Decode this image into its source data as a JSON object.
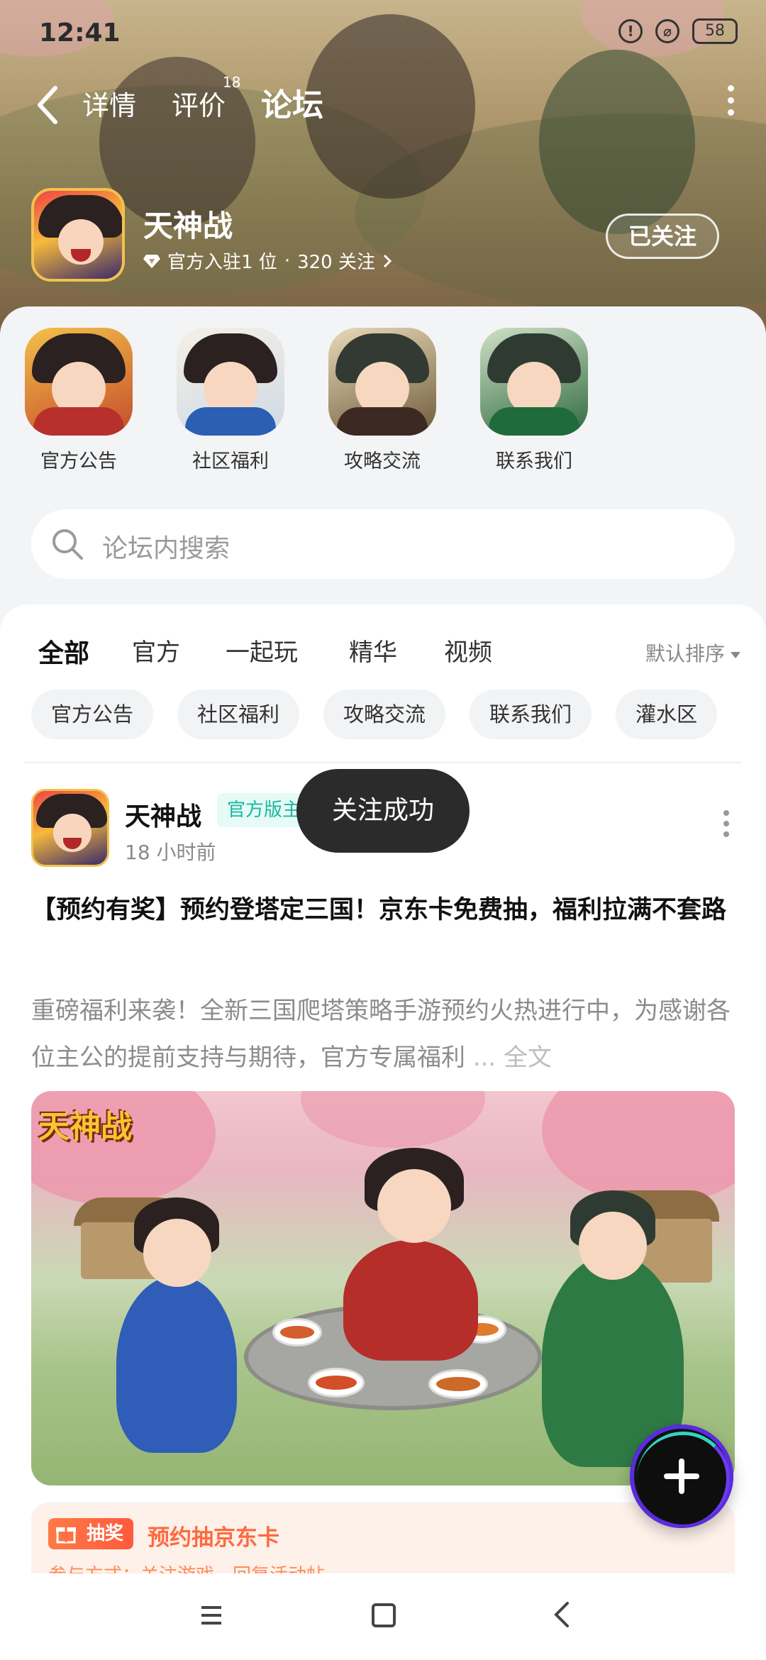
{
  "status_bar": {
    "time": "12:41",
    "battery": "58",
    "alert_icon": "!"
  },
  "nav": {
    "tabs": [
      {
        "label": "详情"
      },
      {
        "label": "评价",
        "badge": "18"
      },
      {
        "label": "论坛"
      }
    ],
    "active_tab": "论坛"
  },
  "forum": {
    "name": "天神战",
    "official_count": "官方入驻1 位",
    "followers": "320 关注",
    "follow_button": "已关注"
  },
  "shortcuts": [
    {
      "label": "官方公告"
    },
    {
      "label": "社区福利"
    },
    {
      "label": "攻略交流"
    },
    {
      "label": "联系我们"
    }
  ],
  "search": {
    "placeholder": "论坛内搜索"
  },
  "filter_tabs": [
    {
      "label": "全部"
    },
    {
      "label": "官方"
    },
    {
      "label": "一起玩"
    },
    {
      "label": "精华"
    },
    {
      "label": "视频"
    }
  ],
  "sort_label": "默认排序",
  "chips": [
    {
      "label": "官方公告"
    },
    {
      "label": "社区福利"
    },
    {
      "label": "攻略交流"
    },
    {
      "label": "联系我们"
    },
    {
      "label": "灌水区"
    }
  ],
  "post": {
    "author": "天神战",
    "role": "官方版主",
    "time": "18 小时前",
    "title": "【预约有奖】预约登塔定三国！京东卡免费抽，福利拉满不套路",
    "excerpt": "重磅福利来袭！全新三国爬塔策略手游预约火热进行中，为感谢各位主公的提前支持与期待，官方专属福利",
    "more": "... 全文",
    "image_logo_text": "天神战"
  },
  "lottery": {
    "tag": "抽奖",
    "text": "预约抽京东卡",
    "sub": "参与方式：关注游戏，回复活动帖"
  },
  "toast": "关注成功",
  "colors": {
    "accent": "#2bd2b6",
    "lottery": "#ff6a3d"
  }
}
